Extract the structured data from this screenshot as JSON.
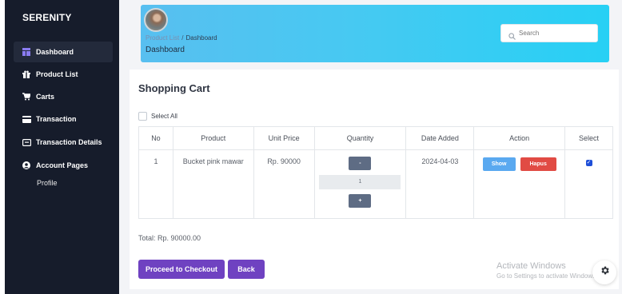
{
  "sidebar": {
    "brand": "SERENITY",
    "items": [
      {
        "label": "Dashboard",
        "icon": "dashboard-icon"
      },
      {
        "label": "Product List",
        "icon": "gift-icon"
      },
      {
        "label": "Carts",
        "icon": "cart-icon"
      },
      {
        "label": "Transaction",
        "icon": "card-icon"
      },
      {
        "label": "Transaction Details",
        "icon": "receipt-icon"
      },
      {
        "label": "Account Pages",
        "icon": "user-icon"
      }
    ],
    "sub_items": [
      {
        "label": "Profile"
      }
    ]
  },
  "header": {
    "breadcrumb_parent": "Product List",
    "breadcrumb_separator": "/",
    "breadcrumb_current": "Dashboard",
    "title": "Dashboard",
    "search_placeholder": "Search"
  },
  "cart": {
    "title": "Shopping Cart",
    "select_all_label": "Select All",
    "columns": [
      "No",
      "Product",
      "Unit Price",
      "Quantity",
      "Date Added",
      "Action",
      "Select"
    ],
    "rows": [
      {
        "no": "1",
        "product": "Bucket pink mawar",
        "unit_price": "Rp. 90000",
        "decrement_label": "-",
        "quantity": "1",
        "increment_label": "+",
        "date_added": "2024-04-03",
        "show_label": "Show",
        "delete_label": "Hapus",
        "selected": true
      }
    ],
    "total": "Total: Rp. 90000.00",
    "checkout_label": "Proceed to Checkout",
    "back_label": "Back"
  },
  "watermark": {
    "title": "Activate Windows",
    "subtitle": "Go to Settings to activate Windows."
  },
  "colors": {
    "sidebar_bg": "#161c2b",
    "header_gradient_start": "#58bff0",
    "header_gradient_end": "#27d0f4",
    "primary_button": "#6f42c1",
    "show_button": "#5aa9f0",
    "delete_button": "#e14b44",
    "quantity_button": "#5e6c84"
  }
}
